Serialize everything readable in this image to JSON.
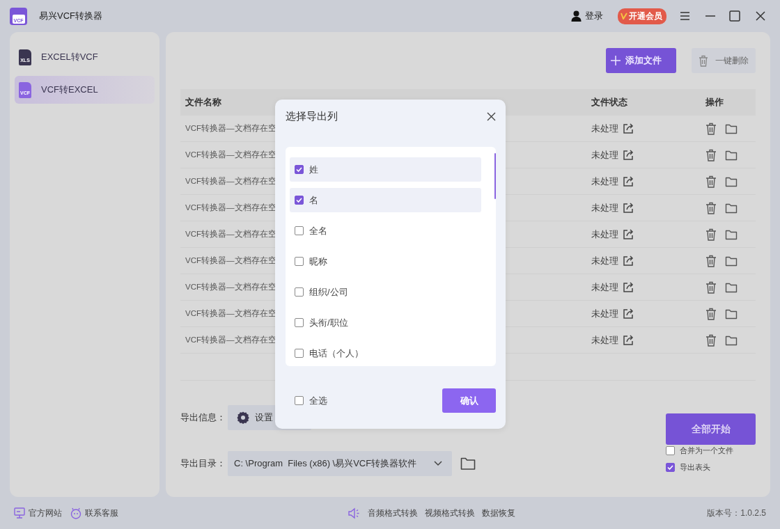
{
  "app": {
    "title": "易兴VCF转换器",
    "logo_text": "VCF"
  },
  "header": {
    "login": "登录",
    "vip_badge": "开通会员"
  },
  "sidebar": {
    "items": [
      {
        "label": "EXCEL转VCF",
        "icon_text": "XLS",
        "selected": false
      },
      {
        "label": "VCF转EXCEL",
        "icon_text": "VCF",
        "selected": true
      }
    ]
  },
  "toolbar": {
    "add_button": "添加文件",
    "delete_button": "一键删除"
  },
  "table": {
    "columns": [
      "文件名称",
      "文件状态",
      "操作"
    ],
    "rows": [
      {
        "name": "VCF转换器—文档存在空",
        "status": "未处理"
      },
      {
        "name": "VCF转换器—文档存在空",
        "status": "未处理"
      },
      {
        "name": "VCF转换器—文档存在空",
        "status": "未处理"
      },
      {
        "name": "VCF转换器—文档存在空",
        "status": "未处理"
      },
      {
        "name": "VCF转换器—文档存在空",
        "status": "未处理"
      },
      {
        "name": "VCF转换器—文档存在空",
        "status": "未处理"
      },
      {
        "name": "VCF转换器—文档存在空",
        "status": "未处理"
      },
      {
        "name": "VCF转换器—文档存在空",
        "status": "未处理"
      },
      {
        "name": "VCF转换器—文档存在空",
        "status": "未处理"
      }
    ]
  },
  "export": {
    "info_label": "导出信息：",
    "settings_button": "设置",
    "dir_label": "导出目录：",
    "dir_value": "C: \\Program  Files (x86) \\易兴VCF转换器软件"
  },
  "start_button": "全部开始",
  "options": [
    {
      "label": "合并为一个文件",
      "checked": false
    },
    {
      "label": "导出表头",
      "checked": true
    }
  ],
  "dialog": {
    "title": "选择导出列",
    "items": [
      {
        "label": "姓",
        "checked": true
      },
      {
        "label": "名",
        "checked": true
      },
      {
        "label": "全名",
        "checked": false
      },
      {
        "label": "昵称",
        "checked": false
      },
      {
        "label": "组织/公司",
        "checked": false
      },
      {
        "label": "头衔/职位",
        "checked": false
      },
      {
        "label": "电话（个人）",
        "checked": false
      }
    ],
    "select_all": {
      "label": "全选",
      "checked": false
    },
    "confirm_button": "确认"
  },
  "footer": {
    "left_links": [
      "官方网站",
      "联系客服"
    ],
    "links": [
      "音频格式转换",
      "视频格式转换",
      "数据恢复"
    ],
    "version": "版本号：1.0.2.5"
  }
}
